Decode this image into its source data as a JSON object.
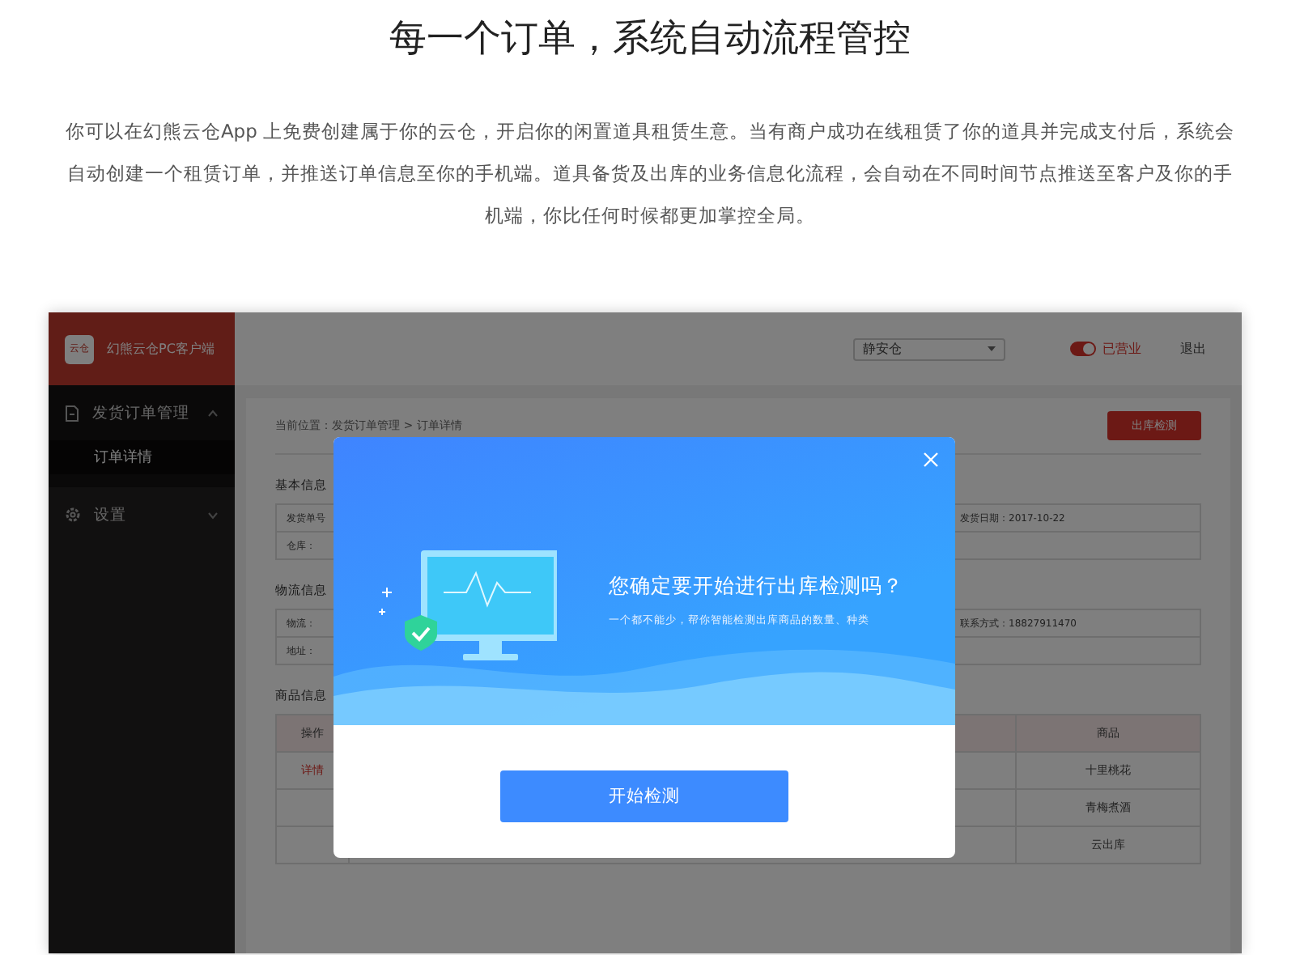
{
  "headline": "每一个订单，系统自动流程管控",
  "intro": "你可以在幻熊云仓App 上免费创建属于你的云仓，开启你的闲置道具租赁生意。当有商户成功在线租赁了你的道具并完成支付后，系统会自动创建一个租赁订单，并推送订单信息至你的手机端。道具备货及出库的业务信息化流程，会自动在不同时间节点推送至客户及你的手机端，你比任何时候都更加掌控全局。",
  "app": {
    "title": "幻熊云仓PC客户端",
    "logo_text": "云仓",
    "sidebar": [
      {
        "label": "发货订单管理",
        "expanded": true,
        "children": [
          {
            "label": "订单详情",
            "selected": true
          }
        ]
      },
      {
        "label": "设置",
        "expanded": false
      }
    ],
    "warehouse_select": {
      "value": "静安仓"
    },
    "business_toggle": {
      "on": true,
      "label": "已营业"
    },
    "logout": "退出",
    "breadcrumb": "当前位置：发货订单管理 > 订单详情",
    "action_button": "出库检测",
    "sections": [
      {
        "title": "基本信息",
        "rows": [
          [
            "发货单号",
            "发货日期：2017-10-22"
          ],
          [
            "仓库：",
            ""
          ]
        ]
      },
      {
        "title": "物流信息",
        "rows": [
          [
            "物流：",
            "联系方式：18827911470"
          ],
          [
            "地址：",
            ""
          ]
        ]
      }
    ],
    "goods": {
      "title": "商品信息",
      "columns": [
        "操作",
        "商品"
      ],
      "rows": [
        {
          "action": "详情",
          "product": "十里桃花"
        },
        {
          "action": "",
          "product": "青梅煮酒"
        },
        {
          "action": "",
          "product": "云出库"
        }
      ]
    }
  },
  "dialog": {
    "title": "您确定要开始进行出库检测吗？",
    "subtitle": "一个都不能少，帮你智能检测出库商品的数量、种类",
    "button": "开始检测"
  }
}
